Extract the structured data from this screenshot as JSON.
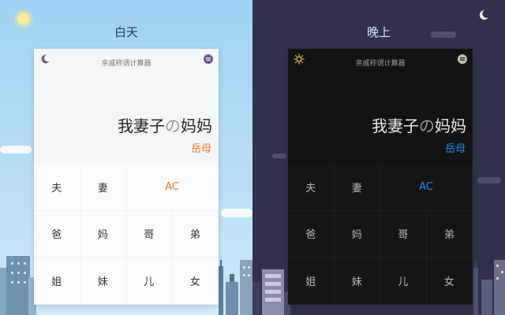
{
  "day": {
    "mode_label": "白天",
    "calc_title": "亲戚称谓计算器",
    "expression": {
      "main": "我妻子",
      "particle": "の",
      "tail": "妈妈"
    },
    "result": "岳母",
    "keys": [
      {
        "label": "夫"
      },
      {
        "label": "妻"
      },
      {
        "label": "AC"
      },
      {
        "label": "爸"
      },
      {
        "label": "妈"
      },
      {
        "label": "哥"
      },
      {
        "label": "弟"
      },
      {
        "label": "姐"
      },
      {
        "label": "妹"
      },
      {
        "label": "儿"
      },
      {
        "label": "女"
      }
    ],
    "header_left_icon": "moon-icon",
    "header_right_icon": "menu-icon",
    "accent_color": "#e87a1e"
  },
  "night": {
    "mode_label": "晚上",
    "calc_title": "亲戚称谓计算器",
    "expression": {
      "main": "我妻子",
      "particle": "の",
      "tail": "妈妈"
    },
    "result": "岳母",
    "keys": [
      {
        "label": "夫"
      },
      {
        "label": "妻"
      },
      {
        "label": "AC"
      },
      {
        "label": "爸"
      },
      {
        "label": "妈"
      },
      {
        "label": "哥"
      },
      {
        "label": "弟"
      },
      {
        "label": "姐"
      },
      {
        "label": "妹"
      },
      {
        "label": "儿"
      },
      {
        "label": "女"
      }
    ],
    "header_left_icon": "sun-icon",
    "header_right_icon": "menu-icon",
    "accent_color": "#1e90e6"
  }
}
